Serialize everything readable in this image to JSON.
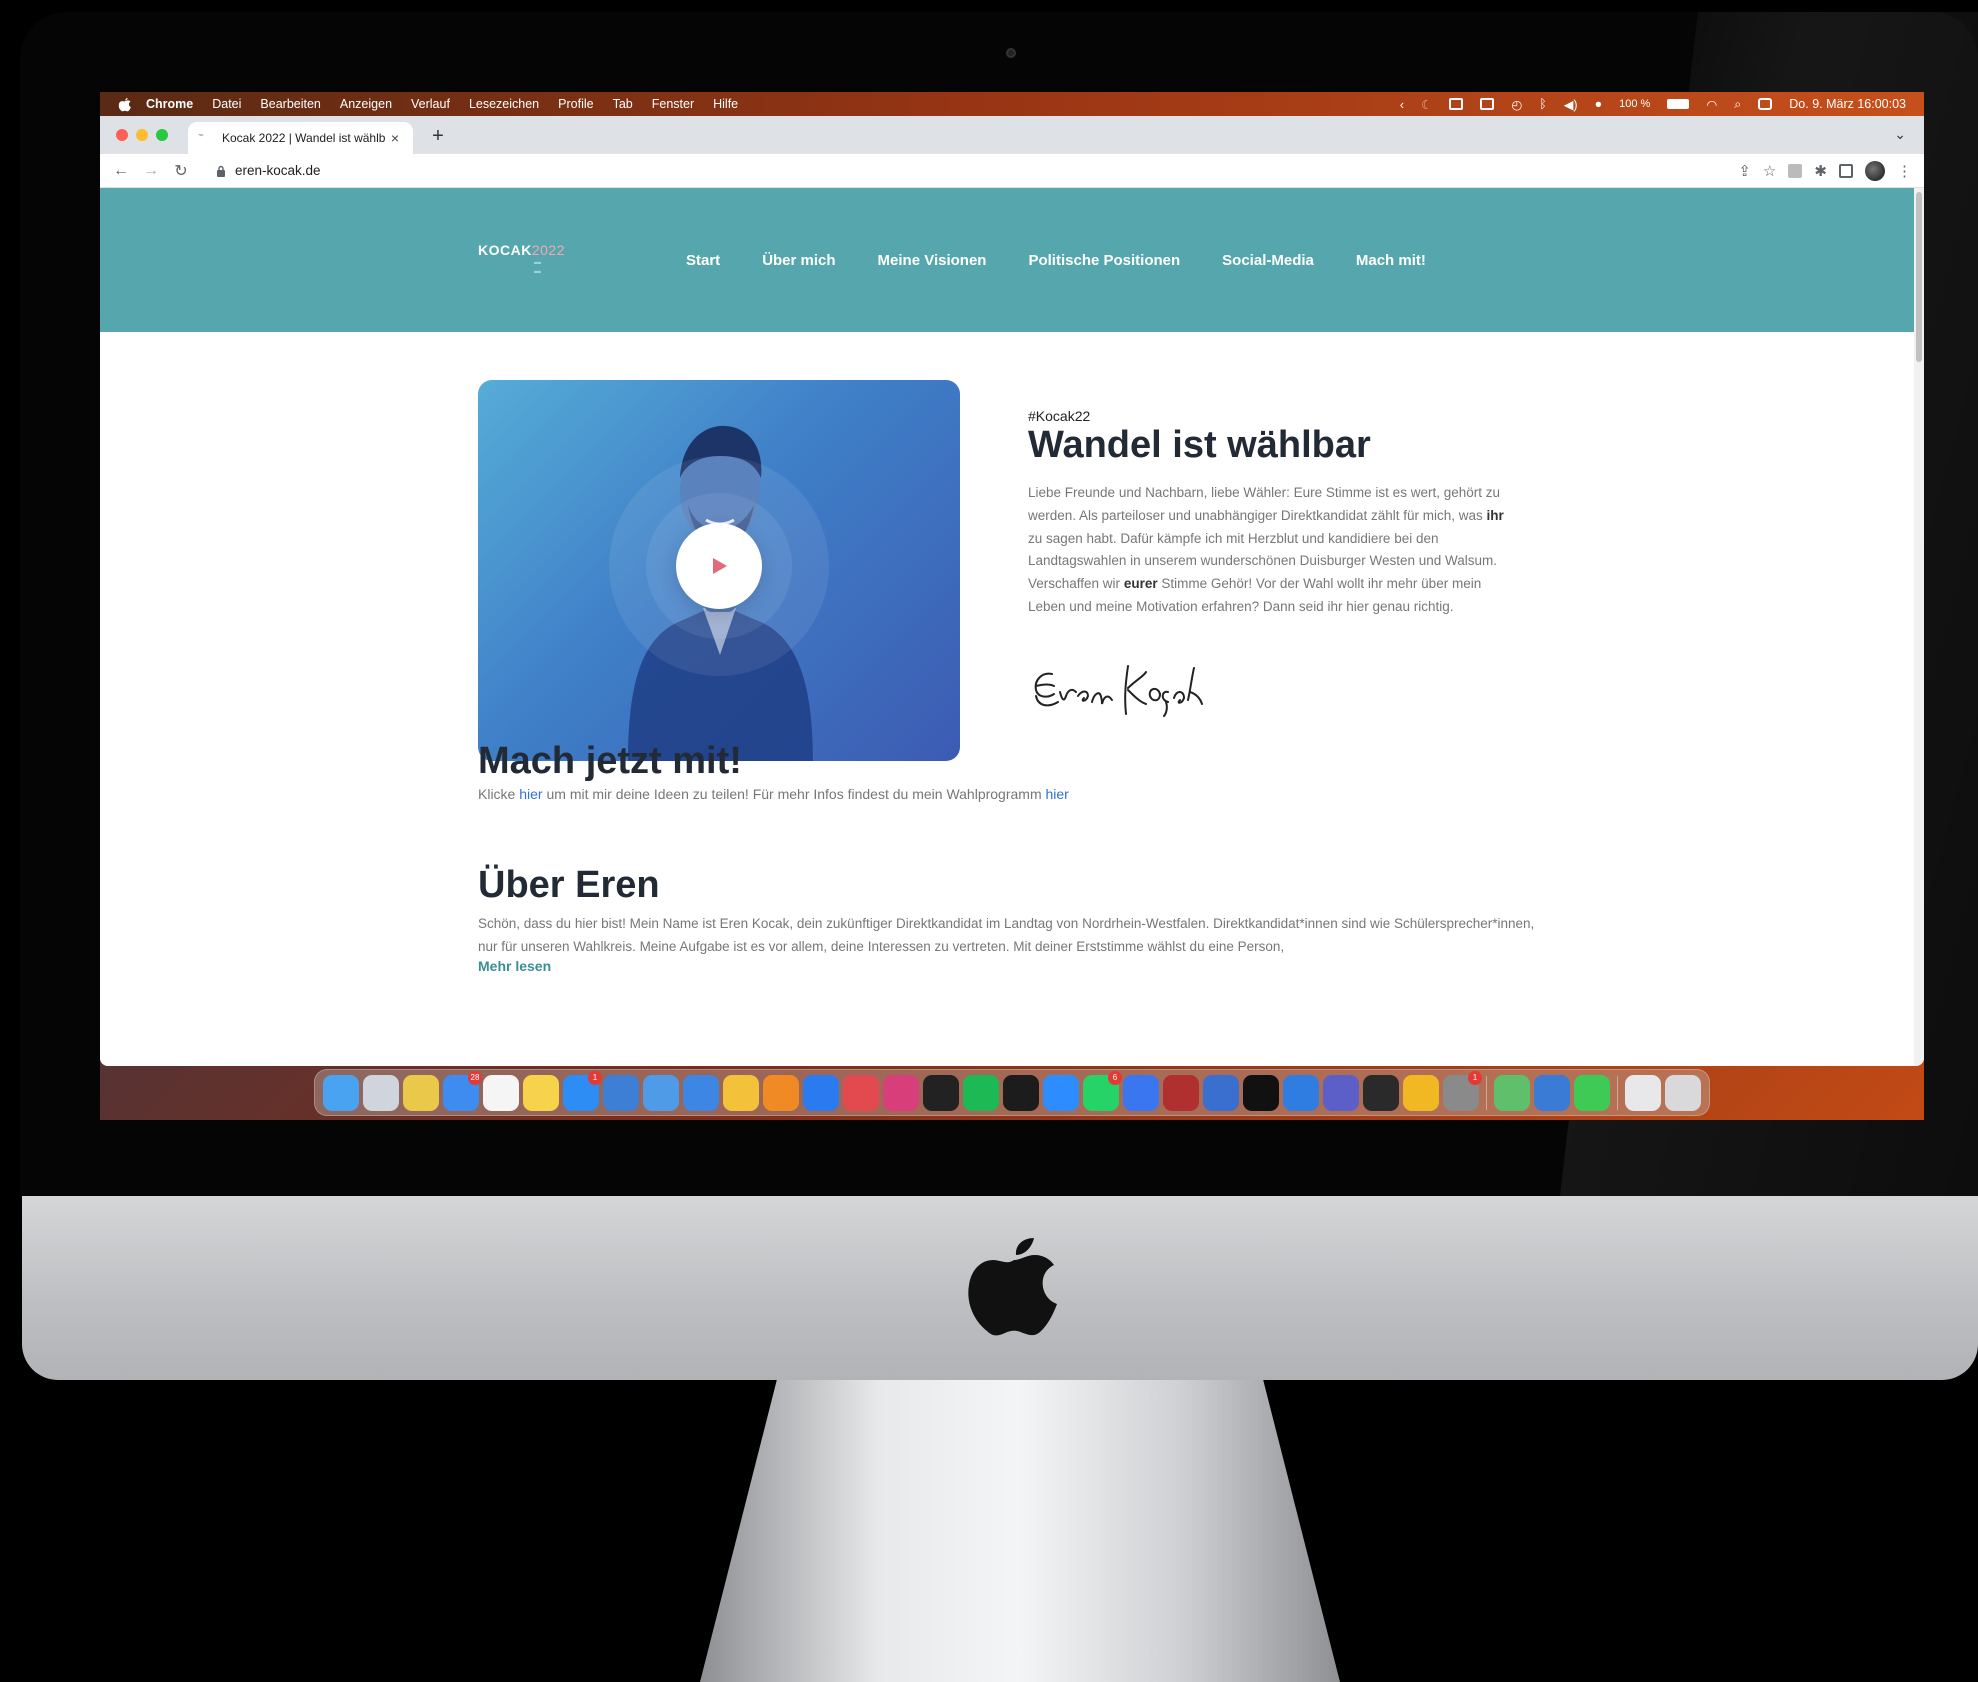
{
  "menubar": {
    "items": [
      "Chrome",
      "Datei",
      "Bearbeiten",
      "Anzeigen",
      "Verlauf",
      "Lesezeichen",
      "Profile",
      "Tab",
      "Fenster",
      "Hilfe"
    ],
    "battery": "100 %",
    "datetime": "Do. 9. März  16:00:03"
  },
  "browser": {
    "tab_title": "Kocak 2022 | Wandel ist wählb",
    "url": "eren-kocak.de"
  },
  "site": {
    "logo_main": "KOCAK",
    "logo_year": "2022",
    "nav": [
      "Start",
      "Über mich",
      "Meine Visionen",
      "Politische Positionen",
      "Social-Media",
      "Mach mit!"
    ],
    "hero": {
      "hashtag": "#Kocak22",
      "title": "Wandel ist wählbar",
      "text_1": "Liebe Freunde und Nachbarn, liebe Wähler: Eure Stimme ist es wert, gehört zu werden. Als parteiloser und unabhängiger Direktkandidat zählt für mich, was ",
      "text_bold_1": "ihr",
      "text_2": " zu sagen habt. Dafür kämpfe ich mit Herzblut und kandidiere bei den Landtagswahlen in unserem wunderschönen Duisburger Westen und Walsum. Verschaffen wir ",
      "text_bold_2": "eurer",
      "text_3": " Stimme Gehör! Vor der Wahl wollt ihr mehr über mein Leben und meine Motivation erfahren? Dann seid ihr hier genau richtig.",
      "signature": "Eren Koçak"
    },
    "mitmachen": {
      "title": "Mach jetzt mit!",
      "text_1": "Klicke ",
      "link_1": "hier",
      "text_2": " um mit mir deine Ideen zu teilen! Für mehr Infos findest du mein Wahlprogramm ",
      "link_2": "hier"
    },
    "about": {
      "title": "Über Eren",
      "text": "Schön, dass du hier bist! Mein Name ist Eren Kocak, dein zukünftiger Direktkandidat im Landtag von Nordrhein-Westfalen. Direktkandidat*innen sind wie Schülersprecher*innen, nur für unseren Wahlkreis. Meine Aufgabe ist es vor allem, deine Interessen zu vertreten. Mit deiner Erststimme wählst du eine Person,",
      "more": "Mehr lesen"
    }
  },
  "colors": {
    "header_teal": "#56a7ad",
    "heading": "#222a35",
    "link_blue": "#2f72d6",
    "more_teal": "#3b8e96",
    "play_red": "#e26a7b"
  },
  "dock": {
    "apps": [
      {
        "name": "finder-icon",
        "color": "#4aa3f0"
      },
      {
        "name": "launchpad-icon",
        "color": "#d0d4dc"
      },
      {
        "name": "chrome-icon",
        "color": "#e9c84a"
      },
      {
        "name": "mail-icon",
        "color": "#3f8cf0",
        "badge": "28"
      },
      {
        "name": "calendar-icon",
        "color": "#f5f5f5"
      },
      {
        "name": "notes-icon",
        "color": "#f7d24b"
      },
      {
        "name": "app-store-icon",
        "color": "#2e8cf5",
        "badge": "1"
      },
      {
        "name": "xcode-icon",
        "color": "#3c7fd4"
      },
      {
        "name": "preview-icon",
        "color": "#4f9be8"
      },
      {
        "name": "testflight-icon",
        "color": "#3e86e4"
      },
      {
        "name": "cyberduck-icon",
        "color": "#f4c13b"
      },
      {
        "name": "sublime-icon",
        "color": "#f08a24"
      },
      {
        "name": "1password-icon",
        "color": "#2a7bf0"
      },
      {
        "name": "creative-cloud-icon",
        "color": "#e34a50"
      },
      {
        "name": "intellij-icon",
        "color": "#d83f7a"
      },
      {
        "name": "final-cut-icon",
        "color": "#222222"
      },
      {
        "name": "spotify-icon",
        "color": "#1db954"
      },
      {
        "name": "terminal-icon",
        "color": "#1c1c1c"
      },
      {
        "name": "zoom-icon",
        "color": "#2d8cff"
      },
      {
        "name": "whatsapp-icon",
        "color": "#25d366",
        "badge": "6"
      },
      {
        "name": "signal-icon",
        "color": "#3a76f0"
      },
      {
        "name": "sequel-icon",
        "color": "#b03030"
      },
      {
        "name": "simulator-icon",
        "color": "#3a6fd0"
      },
      {
        "name": "activity-icon",
        "color": "#111111"
      },
      {
        "name": "screen-sharing-icon",
        "color": "#2f7de0"
      },
      {
        "name": "teams-icon",
        "color": "#5b5fc7"
      },
      {
        "name": "bartender-icon",
        "color": "#2a2a2a"
      },
      {
        "name": "amphetamine-icon",
        "color": "#f2b824"
      },
      {
        "name": "system-preferences-icon",
        "color": "#8a8a8a",
        "badge": "1"
      },
      {
        "name": "maps-icon",
        "color": "#5fbf6a"
      },
      {
        "name": "remote-desktop-icon",
        "color": "#3a7bd5"
      },
      {
        "name": "facetime-icon",
        "color": "#3fca55"
      },
      {
        "name": "downloads-icon",
        "color": "#e8e8ea"
      },
      {
        "name": "trash-icon",
        "color": "#d9d9db"
      }
    ]
  }
}
